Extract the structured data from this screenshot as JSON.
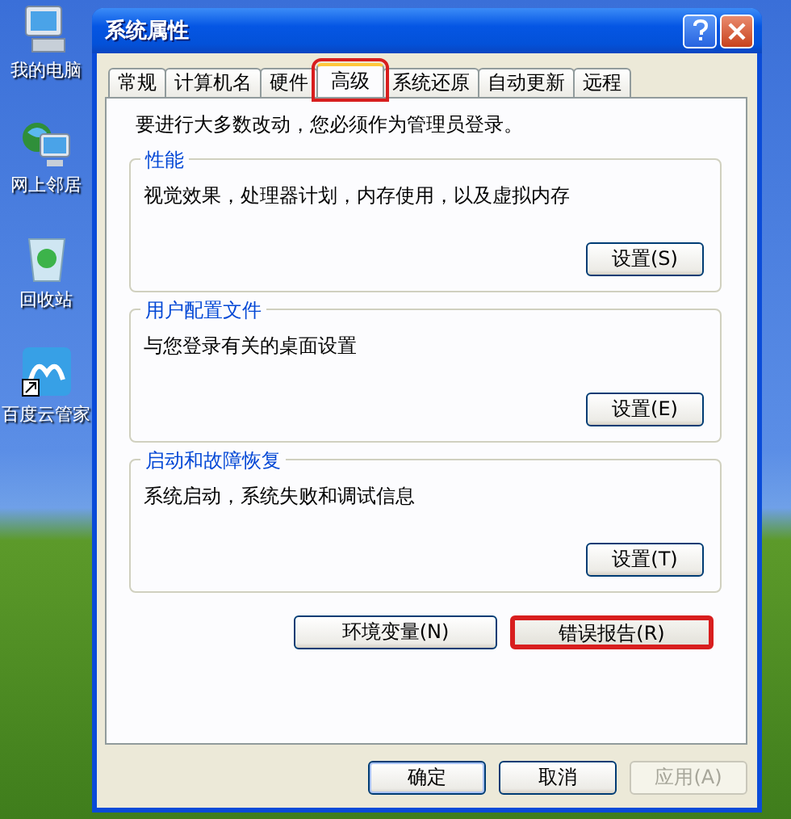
{
  "desktop_icons": [
    {
      "label": "我的电脑",
      "kind": "computer"
    },
    {
      "label": "网上邻居",
      "kind": "network"
    },
    {
      "label": "回收站",
      "kind": "recycle"
    },
    {
      "label": "百度云管家",
      "kind": "cloud"
    }
  ],
  "window": {
    "title": "系统属性"
  },
  "tabs": [
    {
      "label": "常规",
      "selected": false,
      "highlighted": false
    },
    {
      "label": "计算机名",
      "selected": false,
      "highlighted": false
    },
    {
      "label": "硬件",
      "selected": false,
      "highlighted": false
    },
    {
      "label": "高级",
      "selected": true,
      "highlighted": true
    },
    {
      "label": "系统还原",
      "selected": false,
      "highlighted": false
    },
    {
      "label": "自动更新",
      "selected": false,
      "highlighted": false
    },
    {
      "label": "远程",
      "selected": false,
      "highlighted": false
    }
  ],
  "notice": "要进行大多数改动，您必须作为管理员登录。",
  "groups": [
    {
      "title": "性能",
      "description": "视觉效果，处理器计划，内存使用，以及虚拟内存",
      "button": "设置(S)"
    },
    {
      "title": "用户配置文件",
      "description": "与您登录有关的桌面设置",
      "button": "设置(E)"
    },
    {
      "title": "启动和故障恢复",
      "description": "系统启动，系统失败和调试信息",
      "button": "设置(T)"
    }
  ],
  "extra_buttons": [
    {
      "label": "环境变量(N)",
      "highlighted": false
    },
    {
      "label": "错误报告(R)",
      "highlighted": true
    }
  ],
  "dialog_buttons": [
    {
      "label": "确定",
      "disabled": false,
      "default": true
    },
    {
      "label": "取消",
      "disabled": false,
      "default": false
    },
    {
      "label": "应用(A)",
      "disabled": true,
      "default": false
    }
  ]
}
